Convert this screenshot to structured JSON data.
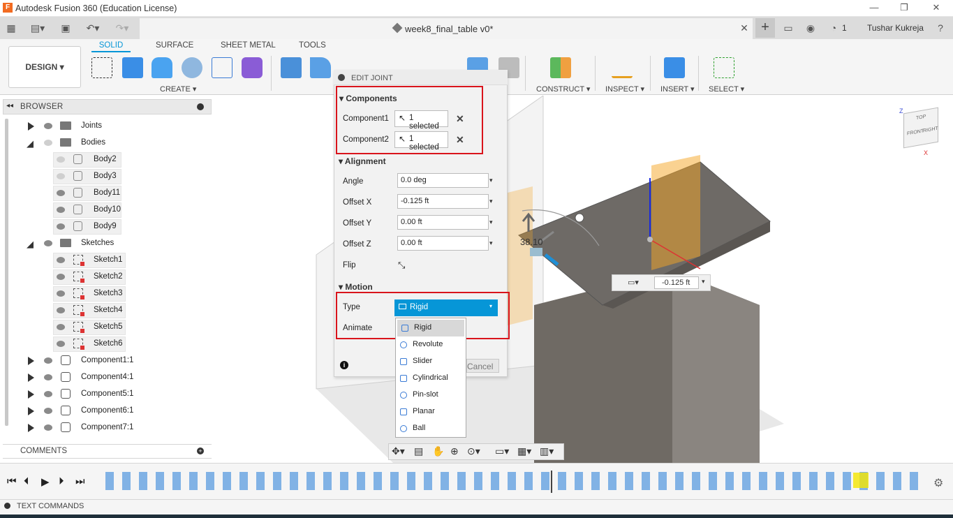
{
  "window": {
    "title": "Autodesk Fusion 360 (Education License)",
    "app_icon": "F"
  },
  "tabbar": {
    "doc_title": "week8_final_table v0*",
    "job_count": "1",
    "user": "Tushar Kukreja"
  },
  "toolbar": {
    "workspace": "DESIGN",
    "tabs": [
      "SOLID",
      "SURFACE",
      "SHEET METAL",
      "TOOLS"
    ],
    "groups": [
      "CREATE",
      "CONSTRUCT",
      "INSPECT",
      "INSERT",
      "SELECT"
    ]
  },
  "browser": {
    "title": "BROWSER",
    "items": [
      {
        "label": "Joints"
      },
      {
        "label": "Bodies"
      },
      {
        "label": "Body2"
      },
      {
        "label": "Body3"
      },
      {
        "label": "Body11"
      },
      {
        "label": "Body10"
      },
      {
        "label": "Body9"
      },
      {
        "label": "Sketches"
      },
      {
        "label": "Sketch1"
      },
      {
        "label": "Sketch2"
      },
      {
        "label": "Sketch3"
      },
      {
        "label": "Sketch4"
      },
      {
        "label": "Sketch5"
      },
      {
        "label": "Sketch6"
      },
      {
        "label": "Component1:1"
      },
      {
        "label": "Component4:1"
      },
      {
        "label": "Component5:1"
      },
      {
        "label": "Component6:1"
      },
      {
        "label": "Component7:1"
      }
    ]
  },
  "comments": {
    "label": "COMMENTS"
  },
  "dialog": {
    "title": "EDIT JOINT",
    "components": {
      "header": "Components",
      "component1_label": "Component1",
      "component1_value": "1 selected",
      "component2_label": "Component2",
      "component2_value": "1 selected"
    },
    "alignment": {
      "header": "Alignment",
      "angle_label": "Angle",
      "angle_value": "0.0 deg",
      "offset_x_label": "Offset X",
      "offset_x_value": "-0.125 ft",
      "offset_y_label": "Offset Y",
      "offset_y_value": "0.00 ft",
      "offset_z_label": "Offset Z",
      "offset_z_value": "0.00 ft",
      "flip_label": "Flip"
    },
    "motion": {
      "header": "Motion",
      "type_label": "Type",
      "type_value": "Rigid",
      "animate_label": "Animate",
      "options": [
        "Rigid",
        "Revolute",
        "Slider",
        "Cylindrical",
        "Pin-slot",
        "Planar",
        "Ball"
      ]
    },
    "cancel_label": "Cancel"
  },
  "viewport": {
    "angle_readout": "38.10",
    "offset_readout": "-0.125 ft"
  },
  "view_cube": {
    "front": "FRONT",
    "right": "RIGHT",
    "top": "TOP",
    "axis_x": "X",
    "axis_z": "Z"
  },
  "textcmd": {
    "label": "TEXT COMMANDS"
  },
  "colors": {
    "accent": "#0696d7",
    "highlight": "#d9141c",
    "orange": "#f5a623"
  }
}
